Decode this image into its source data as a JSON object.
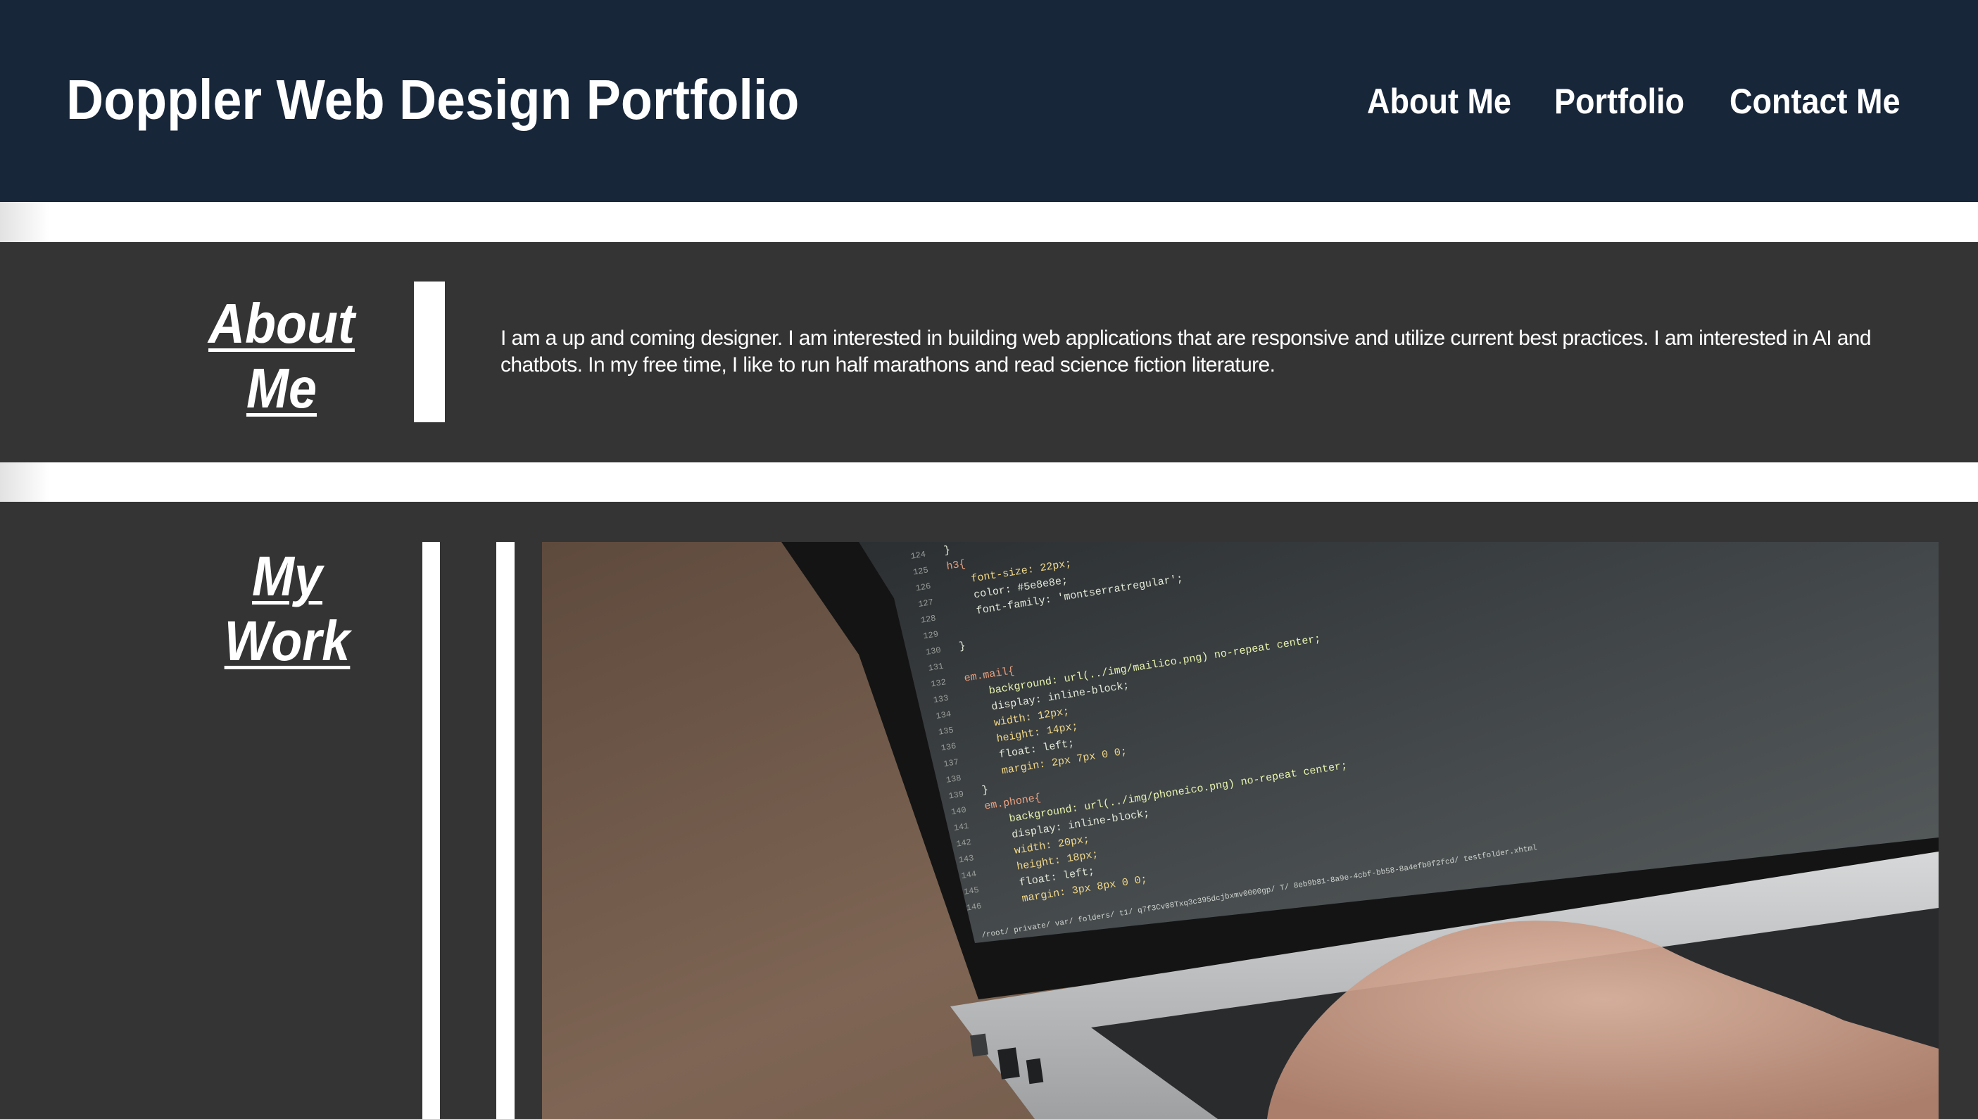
{
  "header": {
    "title": "Doppler Web Design Portfolio",
    "nav": [
      {
        "label": "About Me"
      },
      {
        "label": "Portfolio"
      },
      {
        "label": "Contact Me"
      }
    ]
  },
  "about": {
    "heading_line1": "About",
    "heading_line2": "Me",
    "text": "I am a up and coming designer. I am interested in building web applications that are responsive and utilize current best practices. I am interested in AI and chatbots. In my free time, I like to run half marathons and read science fiction literature."
  },
  "work": {
    "heading_line1": "My",
    "heading_line2": "Work",
    "image_subject": "laptop-with-code-photo",
    "code_lines": [
      {
        "num": "124",
        "code": "}"
      },
      {
        "num": "125",
        "code": "h3{"
      },
      {
        "num": "126",
        "code": "font-size: 22px;"
      },
      {
        "num": "127",
        "code": "color: #5e8e8e;"
      },
      {
        "num": "128",
        "code": "font-family: 'montserratregular';"
      },
      {
        "num": "129",
        "code": ""
      },
      {
        "num": "130",
        "code": "}"
      },
      {
        "num": "131",
        "code": ""
      },
      {
        "num": "132",
        "code": "em.mail{"
      },
      {
        "num": "133",
        "code": "background: url(../img/mailico.png) no-repeat center;"
      },
      {
        "num": "134",
        "code": "display: inline-block;"
      },
      {
        "num": "135",
        "code": "width: 12px;"
      },
      {
        "num": "136",
        "code": "height: 14px;"
      },
      {
        "num": "137",
        "code": "float: left;"
      },
      {
        "num": "138",
        "code": "margin: 2px 7px 0 0;"
      },
      {
        "num": "139",
        "code": "}"
      },
      {
        "num": "140",
        "code": "em.phone{"
      },
      {
        "num": "141",
        "code": "background: url(../img/phoneico.png) no-repeat center;"
      },
      {
        "num": "142",
        "code": "display: inline-block;"
      },
      {
        "num": "143",
        "code": "width: 20px;"
      },
      {
        "num": "144",
        "code": "height: 18px;"
      },
      {
        "num": "145",
        "code": "float: left;"
      },
      {
        "num": "146",
        "code": "margin: 3px 8px 0 0;"
      }
    ],
    "status_path": "/root/ private/ var/ folders/ t1/ q7f3Cv08Txq3c395dcjbxmv0000gp/ T/ 8eb9b81-8a9e-4cbf-bb58-8a4efb0f2fcd/ testfolder.xhtml"
  },
  "colors": {
    "header_bg": "#18263a",
    "section_bg": "#343434",
    "text": "#ffffff",
    "accent_bar": "#ffffff"
  }
}
